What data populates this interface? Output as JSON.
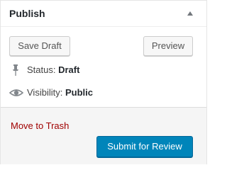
{
  "panel": {
    "title": "Publish",
    "toggle_icon": "triangle-up-icon"
  },
  "actions": {
    "save_draft_label": "Save Draft",
    "preview_label": "Preview"
  },
  "status": {
    "icon": "pin-icon",
    "label": "Status: ",
    "value": "Draft"
  },
  "visibility": {
    "icon": "eye-icon",
    "label": "Visibility: ",
    "value": "Public"
  },
  "footer": {
    "trash_label": "Move to Trash",
    "submit_label": "Submit for Review"
  },
  "colors": {
    "primary": "#0085ba",
    "danger_link": "#a00000",
    "icon_gray": "#82878c"
  }
}
